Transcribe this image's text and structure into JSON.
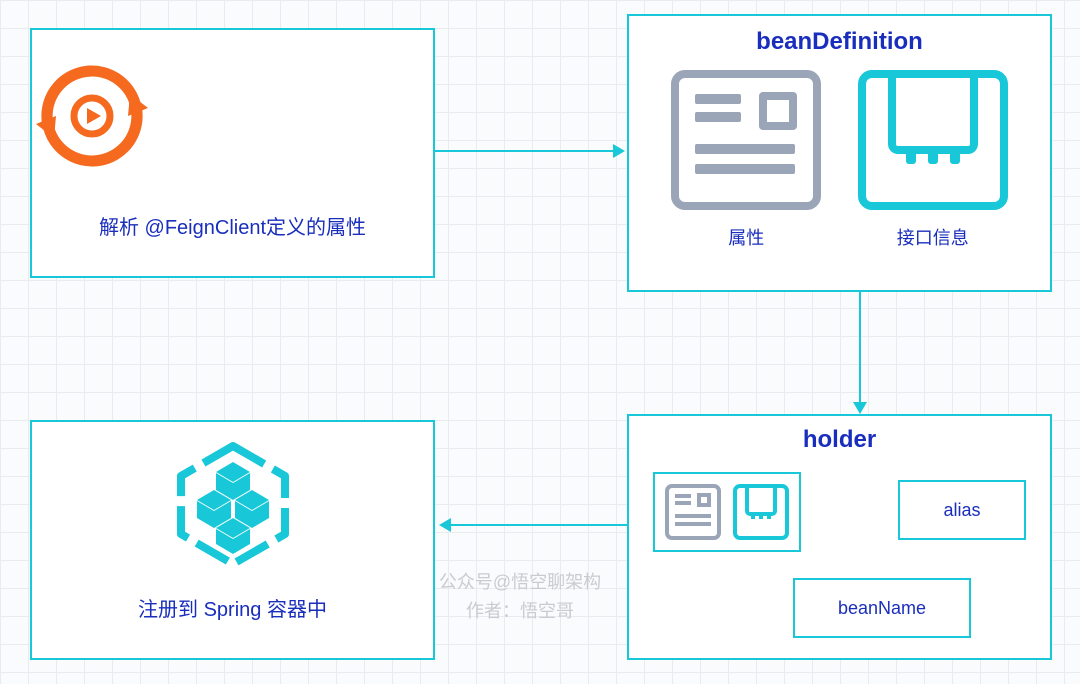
{
  "box1": {
    "caption": "解析 @FeignClient定义的属性"
  },
  "box2": {
    "title": "beanDefinition",
    "item1_label": "属性",
    "item2_label": "接口信息"
  },
  "box3": {
    "title": "holder",
    "alias_label": "alias",
    "beanName_label": "beanName"
  },
  "box4": {
    "caption": "注册到 Spring 容器中"
  },
  "watermark": {
    "line1": "公众号@悟空聊架构",
    "line2": "作者：悟空哥"
  },
  "colors": {
    "border_teal": "#18c8d8",
    "text_blue": "#1a2ebd",
    "icon_gray": "#9aa5b8",
    "icon_orange": "#f56a1f"
  }
}
